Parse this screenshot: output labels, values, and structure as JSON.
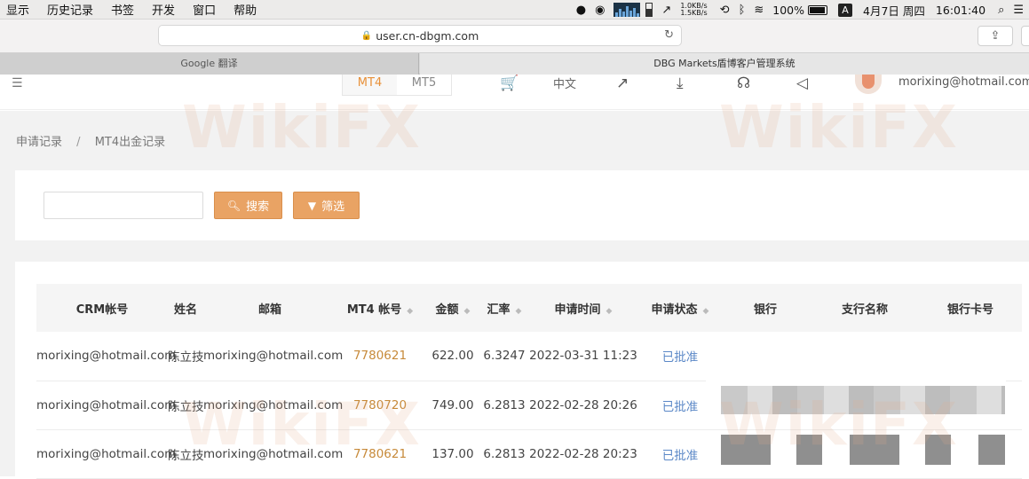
{
  "menubar": {
    "items": [
      "显示",
      "历史记录",
      "书签",
      "开发",
      "窗口",
      "帮助"
    ],
    "net_up": "1.0KB/s",
    "net_down": "1.5KB/s",
    "battery": "100%",
    "input_source": "A",
    "date": "4月7日 周四",
    "time": "16:01:40"
  },
  "browser": {
    "url": "user.cn-dbgm.com",
    "tabs": [
      "Google 翻译",
      "DBG Markets盾博客户管理系统"
    ]
  },
  "header": {
    "platforms": [
      "MT4",
      "MT5"
    ],
    "language": "中文",
    "user_email": "morixing@hotmail.com"
  },
  "breadcrumb": [
    "申请记录",
    "MT4出金记录"
  ],
  "filters": {
    "search_value": "",
    "search_label": "搜索",
    "filter_label": "筛选"
  },
  "table": {
    "columns": [
      "CRM帐号",
      "姓名",
      "邮箱",
      "MT4 帐号",
      "金额",
      "汇率",
      "申请时间",
      "申请状态",
      "银行",
      "支行名称",
      "银行卡号"
    ],
    "rows": [
      [
        "morixing@hotmail.com",
        "陈立技",
        "morixing@hotmail.com",
        "7780621",
        "622.00",
        "6.3247",
        "2022-03-31 11:23",
        "已批准"
      ],
      [
        "morixing@hotmail.com",
        "陈立技",
        "morixing@hotmail.com",
        "7780720",
        "749.00",
        "6.2813",
        "2022-02-28 20:26",
        "已批准"
      ],
      [
        "morixing@hotmail.com",
        "陈立技",
        "morixing@hotmail.com",
        "7780621",
        "137.00",
        "6.2813",
        "2022-02-28 20:23",
        "已批准"
      ]
    ]
  },
  "watermark": "WikiFX"
}
